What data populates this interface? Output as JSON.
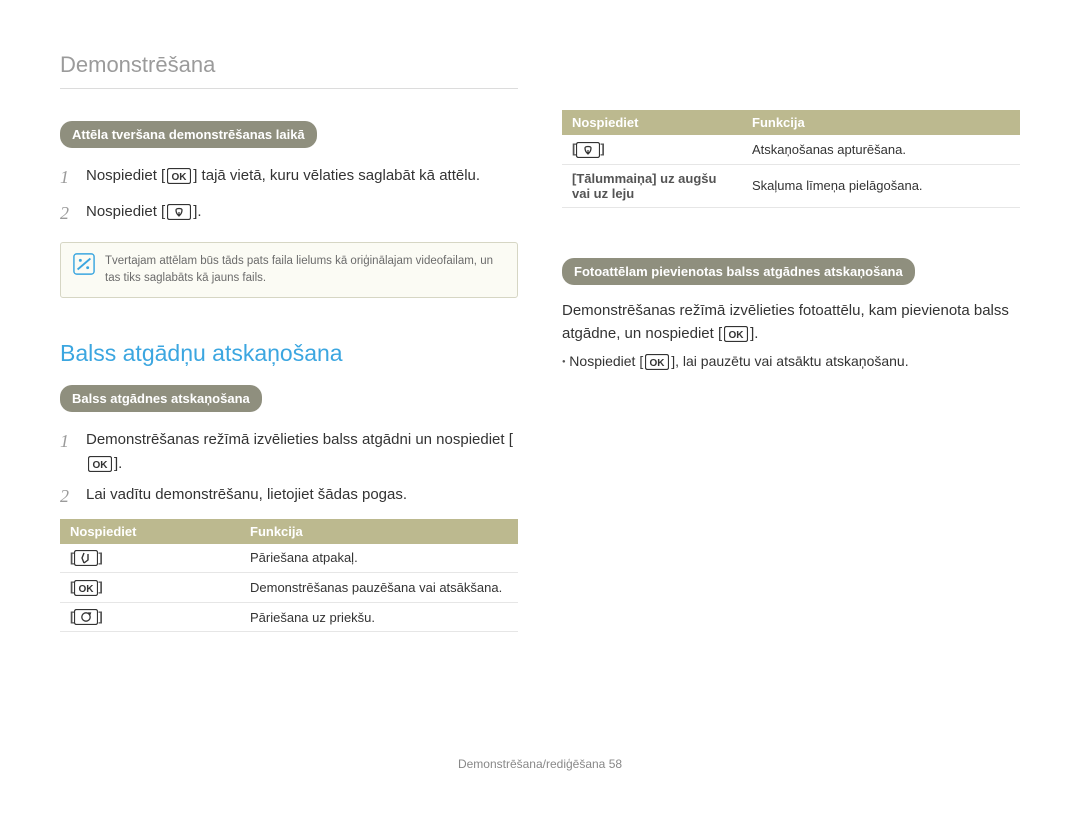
{
  "header": {
    "title": "Demonstrēšana"
  },
  "left": {
    "pill1": "Attēla tveršana demonstrēšanas laikā",
    "step1_a": "Nospiediet [",
    "step1_b": "] tajā vietā, kuru vēlaties saglabāt kā attēlu.",
    "step2_a": "Nospiediet [",
    "step2_b": "].",
    "note": "Tvertajam attēlam būs tāds pats faila lielums kā oriģinālajam videofailam, un tas tiks saglabāts kā jauns fails.",
    "h2": "Balss atgādņu atskaņošana",
    "pill2": "Balss atgādnes atskaņošana",
    "vm_step1_a": "Demonstrēšanas režīmā izvēlieties balss atgādni un nospiediet [",
    "vm_step1_b": "].",
    "vm_step2": "Lai vadītu demonstrēšanu, lietojiet šādas pogas.",
    "table_h1": "Nospiediet",
    "table_h2": "Funkcija",
    "rows": {
      "r1_fn": "Pāriešana atpakaļ.",
      "r2_fn": "Demonstrēšanas pauzēšana vai atsākšana.",
      "r3_fn": "Pāriešana uz priekšu."
    }
  },
  "right": {
    "table_h1": "Nospiediet",
    "table_h2": "Funkcija",
    "rows": {
      "r1_fn": "Atskaņošanas apturēšana.",
      "r2_key": "[Tālummaiņa] uz augšu vai uz leju",
      "r2_fn": "Skaļuma līmeņa pielāgošana."
    },
    "pill": "Fotoattēlam pievienotas balss atgādnes atskaņošana",
    "para_a": "Demonstrēšanas režīmā izvēlieties fotoattēlu, kam pievienota balss atgādne, un nospiediet [",
    "para_b": "].",
    "bullet_a": "Nospiediet [",
    "bullet_b": "], lai pauzētu vai atsāktu atskaņošanu."
  },
  "footer": {
    "text": "Demonstrēšana/rediģēšana  58"
  }
}
